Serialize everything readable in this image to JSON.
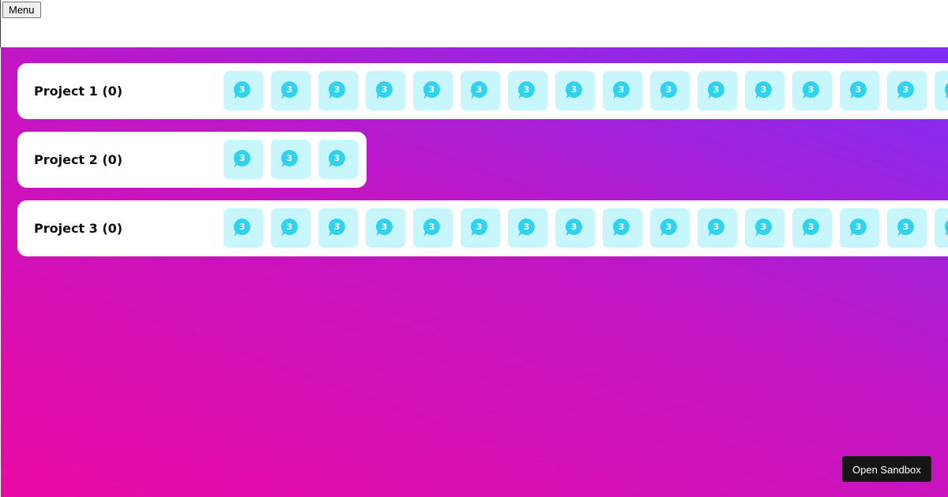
{
  "header": {
    "menu_label": "Menu"
  },
  "projects": [
    {
      "title": "Project 1 (0)",
      "tile_count": 16,
      "visible_tiles": 16,
      "badge": "3"
    },
    {
      "title": "Project 2 (0)",
      "tile_count": 3,
      "visible_tiles": 3,
      "badge": "3"
    },
    {
      "title": "Project 3 (0)",
      "tile_count": 16,
      "visible_tiles": 16,
      "badge": "3"
    }
  ],
  "tile_icon": "chat-bubble-icon",
  "colors": {
    "tile_bg": "#c8f6fd",
    "bubble": "#2fd3f0",
    "gradient_start": "#ea0aa4",
    "gradient_mid": "#c116c4",
    "gradient_end": "#7b2ff7",
    "sandbox_bg": "#151515"
  },
  "footer": {
    "sandbox_label": "Open Sandbox"
  }
}
